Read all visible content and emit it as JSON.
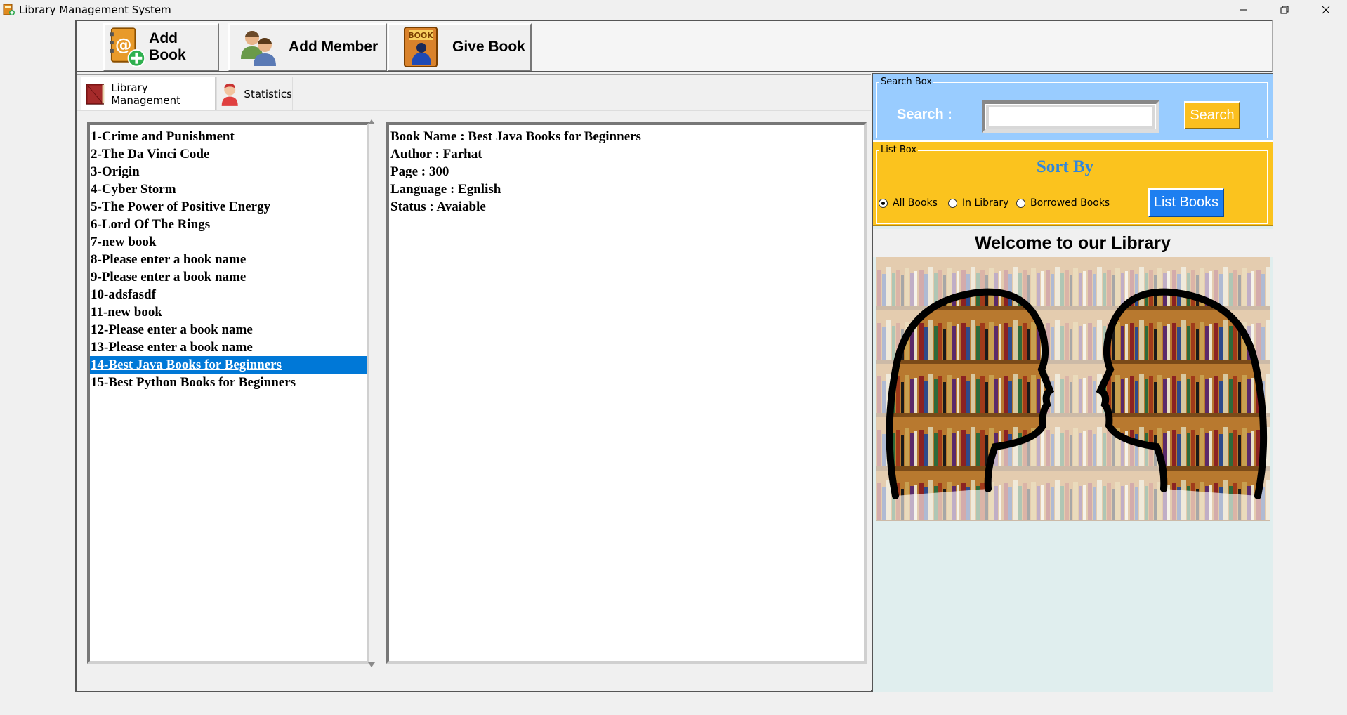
{
  "window": {
    "title": "Library Management System"
  },
  "toolbar": {
    "add_book": "Add Book",
    "add_member": "Add Member",
    "give_book": "Give Book",
    "give_book_icon_text": "BOOK"
  },
  "tabs": [
    {
      "label": "Library Management",
      "active": true
    },
    {
      "label": "Statistics",
      "active": false
    }
  ],
  "book_list": [
    "1-Crime and Punishment",
    "2-The Da Vinci Code",
    "3-Origin",
    "4-Cyber Storm",
    "5-The Power of Positive Energy",
    "6-Lord Of The Rings",
    "7-new book",
    "8-Please enter a book name",
    "9-Please enter a book name",
    "10-adsfasdf",
    "11-new book",
    "12-Please enter a book name",
    "13-Please enter a book name",
    "14-Best Java Books for Beginners",
    "15-Best Python Books for Beginners"
  ],
  "selected_book_index": 13,
  "details": [
    "Book Name : Best Java Books for Beginners",
    "Author : Farhat",
    "Page : 300",
    "Language : Egnlish",
    "Status : Avaiable"
  ],
  "search": {
    "legend": "Search Box",
    "label": "Search :",
    "value": "",
    "button": "Search"
  },
  "list_box": {
    "legend": "List Box",
    "title": "Sort By",
    "options": [
      {
        "label": "All Books",
        "checked": true
      },
      {
        "label": "In Library",
        "checked": false
      },
      {
        "label": "Borrowed Books",
        "checked": false
      }
    ],
    "button": "List Books"
  },
  "welcome": "Welcome to our Library",
  "colors": {
    "search_bg": "#99ccff",
    "listbox_bg": "#fbc31e",
    "selection": "#0078d7",
    "sort_by": "#2e86de",
    "list_button": "#1e7ff0",
    "search_button": "#fbbf1f",
    "panel_bg": "#e0eeee"
  }
}
